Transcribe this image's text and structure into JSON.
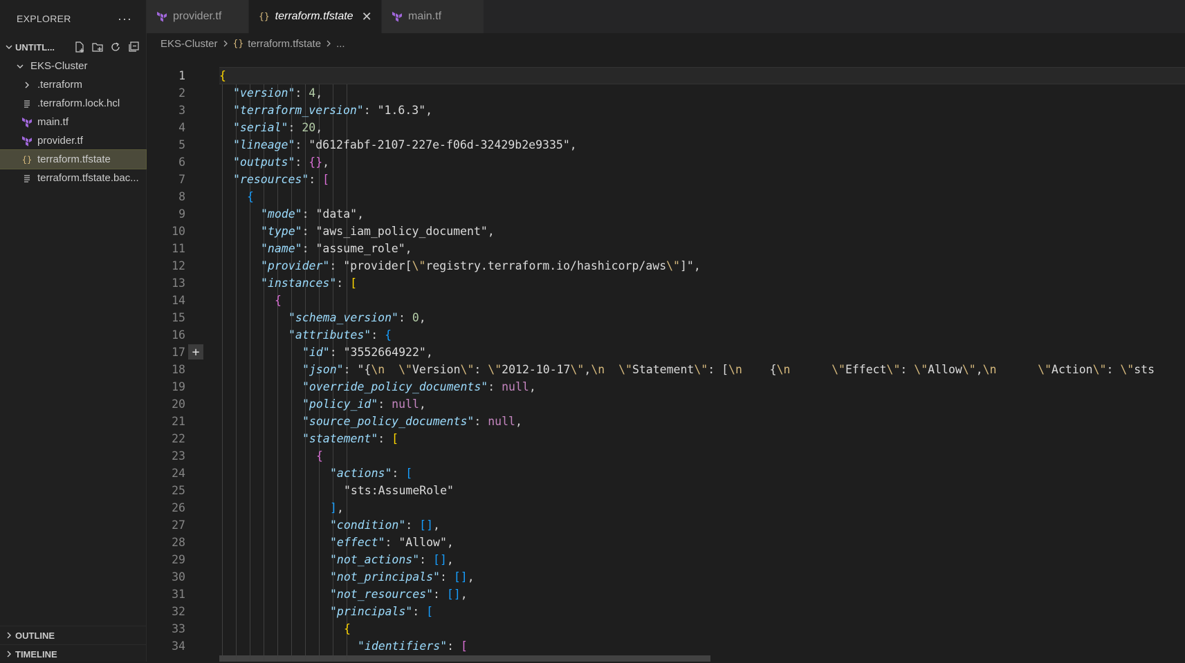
{
  "explorer": {
    "title": "EXPLORER",
    "more": "···",
    "workspace": "UNTITL...",
    "folder": "EKS-Cluster",
    "items": [
      {
        "label": ".terraform",
        "kind": "folder"
      },
      {
        "label": ".terraform.lock.hcl",
        "kind": "lines"
      },
      {
        "label": "main.tf",
        "kind": "terraform"
      },
      {
        "label": "provider.tf",
        "kind": "terraform"
      },
      {
        "label": "terraform.tfstate",
        "kind": "json",
        "selected": true
      },
      {
        "label": "terraform.tfstate.bac...",
        "kind": "lines"
      }
    ],
    "outline": "OUTLINE",
    "timeline": "TIMELINE"
  },
  "tabs": [
    {
      "label": "provider.tf",
      "kind": "terraform"
    },
    {
      "label": "terraform.tfstate",
      "kind": "json",
      "active": true
    },
    {
      "label": "main.tf",
      "kind": "terraform"
    }
  ],
  "breadcrumb": {
    "folder": "EKS-Cluster",
    "icon": "{}",
    "file": "terraform.tfstate",
    "more": "..."
  },
  "colors": {
    "terraform": "#a067da",
    "json_icon": "#d7ba7d",
    "accent": "#007acc"
  },
  "editor": {
    "lines": [
      {
        "n": "1",
        "indent": 0,
        "t": [
          [
            "b1",
            "{"
          ]
        ]
      },
      {
        "n": "2",
        "indent": 1,
        "t": [
          [
            "k",
            "\"version\""
          ],
          [
            "p",
            ": "
          ],
          [
            "n",
            "4"
          ],
          [
            "p",
            ","
          ]
        ]
      },
      {
        "n": "3",
        "indent": 1,
        "t": [
          [
            "k",
            "\"terraform_version\""
          ],
          [
            "p",
            ": "
          ],
          [
            "s",
            "\"1.6.3\""
          ],
          [
            "p",
            ","
          ]
        ]
      },
      {
        "n": "4",
        "indent": 1,
        "t": [
          [
            "k",
            "\"serial\""
          ],
          [
            "p",
            ": "
          ],
          [
            "n",
            "20"
          ],
          [
            "p",
            ","
          ]
        ]
      },
      {
        "n": "5",
        "indent": 1,
        "t": [
          [
            "k",
            "\"lineage\""
          ],
          [
            "p",
            ": "
          ],
          [
            "s",
            "\"d612fabf-2107-227e-f06d-32429b2e9335\""
          ],
          [
            "p",
            ","
          ]
        ]
      },
      {
        "n": "6",
        "indent": 1,
        "t": [
          [
            "k",
            "\"outputs\""
          ],
          [
            "p",
            ": "
          ],
          [
            "b2",
            "{}"
          ],
          [
            "p",
            ","
          ]
        ]
      },
      {
        "n": "7",
        "indent": 1,
        "t": [
          [
            "k",
            "\"resources\""
          ],
          [
            "p",
            ": "
          ],
          [
            "b2",
            "["
          ]
        ]
      },
      {
        "n": "8",
        "indent": 2,
        "t": [
          [
            "b3",
            "{"
          ]
        ]
      },
      {
        "n": "9",
        "indent": 3,
        "t": [
          [
            "k",
            "\"mode\""
          ],
          [
            "p",
            ": "
          ],
          [
            "s",
            "\"data\""
          ],
          [
            "p",
            ","
          ]
        ]
      },
      {
        "n": "10",
        "indent": 3,
        "t": [
          [
            "k",
            "\"type\""
          ],
          [
            "p",
            ": "
          ],
          [
            "s",
            "\"aws_iam_policy_document\""
          ],
          [
            "p",
            ","
          ]
        ]
      },
      {
        "n": "11",
        "indent": 3,
        "t": [
          [
            "k",
            "\"name\""
          ],
          [
            "p",
            ": "
          ],
          [
            "s",
            "\"assume_role\""
          ],
          [
            "p",
            ","
          ]
        ]
      },
      {
        "n": "12",
        "indent": 3,
        "t": [
          [
            "k",
            "\"provider\""
          ],
          [
            "p",
            ": "
          ],
          [
            "s",
            "\"provider["
          ],
          [
            "e",
            "\\\""
          ],
          [
            "s",
            "registry.terraform.io/hashicorp/aws"
          ],
          [
            "e",
            "\\\""
          ],
          [
            "s",
            "]\""
          ],
          [
            "p",
            ","
          ]
        ]
      },
      {
        "n": "13",
        "indent": 3,
        "t": [
          [
            "k",
            "\"instances\""
          ],
          [
            "p",
            ": "
          ],
          [
            "b1",
            "["
          ]
        ]
      },
      {
        "n": "14",
        "indent": 4,
        "t": [
          [
            "b2",
            "{"
          ]
        ]
      },
      {
        "n": "15",
        "indent": 5,
        "t": [
          [
            "k",
            "\"schema_version\""
          ],
          [
            "p",
            ": "
          ],
          [
            "n",
            "0"
          ],
          [
            "p",
            ","
          ]
        ]
      },
      {
        "n": "16",
        "indent": 5,
        "t": [
          [
            "k",
            "\"attributes\""
          ],
          [
            "p",
            ": "
          ],
          [
            "b3",
            "{"
          ]
        ]
      },
      {
        "n": "17",
        "indent": 6,
        "t": [
          [
            "k",
            "\"id\""
          ],
          [
            "p",
            ": "
          ],
          [
            "s",
            "\"3552664922\""
          ],
          [
            "p",
            ","
          ]
        ]
      },
      {
        "n": "18",
        "indent": 6,
        "t": [
          [
            "k",
            "\"json\""
          ],
          [
            "p",
            ": "
          ],
          [
            "s",
            "\"{"
          ],
          [
            "e",
            "\\n"
          ],
          [
            "s",
            "  "
          ],
          [
            "e",
            "\\\""
          ],
          [
            "s",
            "Version"
          ],
          [
            "e",
            "\\\""
          ],
          [
            "s",
            ": "
          ],
          [
            "e",
            "\\\""
          ],
          [
            "s",
            "2012-10-17"
          ],
          [
            "e",
            "\\\""
          ],
          [
            "s",
            ","
          ],
          [
            "e",
            "\\n"
          ],
          [
            "s",
            "  "
          ],
          [
            "e",
            "\\\""
          ],
          [
            "s",
            "Statement"
          ],
          [
            "e",
            "\\\""
          ],
          [
            "s",
            ": ["
          ],
          [
            "e",
            "\\n"
          ],
          [
            "s",
            "    {"
          ],
          [
            "e",
            "\\n"
          ],
          [
            "s",
            "      "
          ],
          [
            "e",
            "\\\""
          ],
          [
            "s",
            "Effect"
          ],
          [
            "e",
            "\\\""
          ],
          [
            "s",
            ": "
          ],
          [
            "e",
            "\\\""
          ],
          [
            "s",
            "Allow"
          ],
          [
            "e",
            "\\\""
          ],
          [
            "s",
            ","
          ],
          [
            "e",
            "\\n"
          ],
          [
            "s",
            "      "
          ],
          [
            "e",
            "\\\""
          ],
          [
            "s",
            "Action"
          ],
          [
            "e",
            "\\\""
          ],
          [
            "s",
            ": "
          ],
          [
            "e",
            "\\\""
          ],
          [
            "s",
            "sts"
          ]
        ]
      },
      {
        "n": "19",
        "indent": 6,
        "t": [
          [
            "k",
            "\"override_policy_documents\""
          ],
          [
            "p",
            ": "
          ],
          [
            "kw",
            "null"
          ],
          [
            "p",
            ","
          ]
        ]
      },
      {
        "n": "20",
        "indent": 6,
        "t": [
          [
            "k",
            "\"policy_id\""
          ],
          [
            "p",
            ": "
          ],
          [
            "kw",
            "null"
          ],
          [
            "p",
            ","
          ]
        ]
      },
      {
        "n": "21",
        "indent": 6,
        "t": [
          [
            "k",
            "\"source_policy_documents\""
          ],
          [
            "p",
            ": "
          ],
          [
            "kw",
            "null"
          ],
          [
            "p",
            ","
          ]
        ]
      },
      {
        "n": "22",
        "indent": 6,
        "t": [
          [
            "k",
            "\"statement\""
          ],
          [
            "p",
            ": "
          ],
          [
            "b1",
            "["
          ]
        ]
      },
      {
        "n": "23",
        "indent": 7,
        "t": [
          [
            "b2",
            "{"
          ]
        ]
      },
      {
        "n": "24",
        "indent": 8,
        "t": [
          [
            "k",
            "\"actions\""
          ],
          [
            "p",
            ": "
          ],
          [
            "b3",
            "["
          ]
        ]
      },
      {
        "n": "25",
        "indent": 9,
        "t": [
          [
            "s",
            "\"sts:AssumeRole\""
          ]
        ]
      },
      {
        "n": "26",
        "indent": 8,
        "t": [
          [
            "b3",
            "]"
          ],
          [
            "p",
            ","
          ]
        ]
      },
      {
        "n": "27",
        "indent": 8,
        "t": [
          [
            "k",
            "\"condition\""
          ],
          [
            "p",
            ": "
          ],
          [
            "b3",
            "[]"
          ],
          [
            "p",
            ","
          ]
        ]
      },
      {
        "n": "28",
        "indent": 8,
        "t": [
          [
            "k",
            "\"effect\""
          ],
          [
            "p",
            ": "
          ],
          [
            "s",
            "\"Allow\""
          ],
          [
            "p",
            ","
          ]
        ]
      },
      {
        "n": "29",
        "indent": 8,
        "t": [
          [
            "k",
            "\"not_actions\""
          ],
          [
            "p",
            ": "
          ],
          [
            "b3",
            "[]"
          ],
          [
            "p",
            ","
          ]
        ]
      },
      {
        "n": "30",
        "indent": 8,
        "t": [
          [
            "k",
            "\"not_principals\""
          ],
          [
            "p",
            ": "
          ],
          [
            "b3",
            "[]"
          ],
          [
            "p",
            ","
          ]
        ]
      },
      {
        "n": "31",
        "indent": 8,
        "t": [
          [
            "k",
            "\"not_resources\""
          ],
          [
            "p",
            ": "
          ],
          [
            "b3",
            "[]"
          ],
          [
            "p",
            ","
          ]
        ]
      },
      {
        "n": "32",
        "indent": 8,
        "t": [
          [
            "k",
            "\"principals\""
          ],
          [
            "p",
            ": "
          ],
          [
            "b3",
            "["
          ]
        ]
      },
      {
        "n": "33",
        "indent": 9,
        "t": [
          [
            "b1",
            "{"
          ]
        ]
      },
      {
        "n": "34",
        "indent": 10,
        "t": [
          [
            "k",
            "\"identifiers\""
          ],
          [
            "p",
            ": "
          ],
          [
            "b2",
            "["
          ]
        ]
      }
    ]
  }
}
